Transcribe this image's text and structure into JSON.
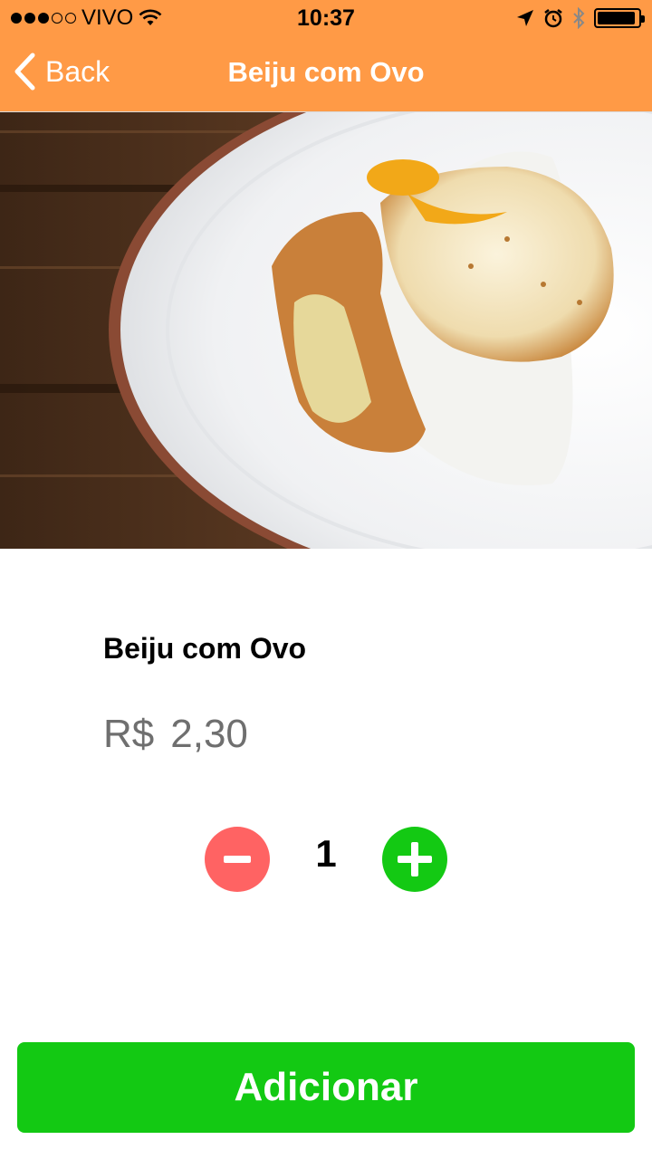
{
  "status_bar": {
    "carrier": "VIVO",
    "time": "10:37",
    "signal_bars_filled": 3,
    "signal_bars_total": 5,
    "battery_level": 0.85,
    "icons": [
      "wifi-icon",
      "location-arrow-icon",
      "alarm-icon",
      "bluetooth-icon",
      "battery-icon"
    ]
  },
  "nav": {
    "back_label": "Back",
    "title": "Beiju com Ovo",
    "background_color": "#FF9A46"
  },
  "product": {
    "name": "Beiju com Ovo",
    "currency": "R$",
    "price": "2,30",
    "image_description_icon": "food-photo"
  },
  "quantity": {
    "value": "1",
    "decrement_icon": "minus-icon",
    "increment_icon": "plus-icon",
    "decrement_color": "#FF6363",
    "increment_color": "#13C913"
  },
  "action": {
    "add_label": "Adicionar",
    "color": "#13C913"
  }
}
